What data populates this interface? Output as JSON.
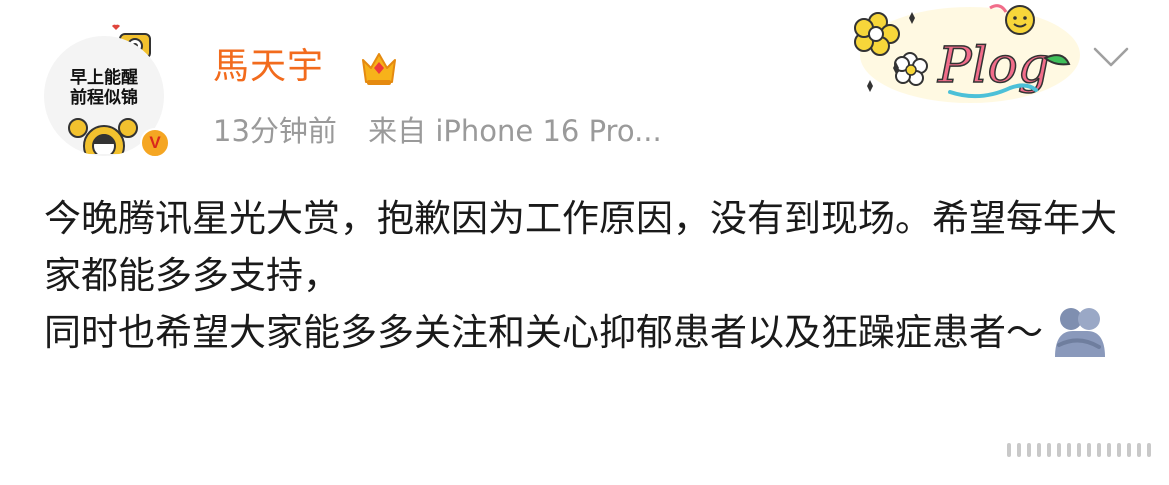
{
  "post": {
    "author": {
      "name": "馬天宇",
      "avatar_text_line1": "早上能醒",
      "avatar_text_line2": "前程似锦",
      "verified_badge": "V",
      "crown_icon": "crown-icon"
    },
    "meta": {
      "time": "13分钟前",
      "source": "来自 iPhone 16 Pro..."
    },
    "decoration": {
      "badge_text": "Plog"
    },
    "content": {
      "line1": "今晚腾讯星光大赏，抱歉因为工作原因，没有到现场。希望每年大家都能多多支持，",
      "line2": "同时也希望大家能多多关注和关心抑郁患者以及狂躁症患者～"
    }
  },
  "colors": {
    "username": "#f26b1d",
    "meta": "#9a9a9a",
    "text": "#1a1a1a",
    "badge": "#f5a623"
  }
}
